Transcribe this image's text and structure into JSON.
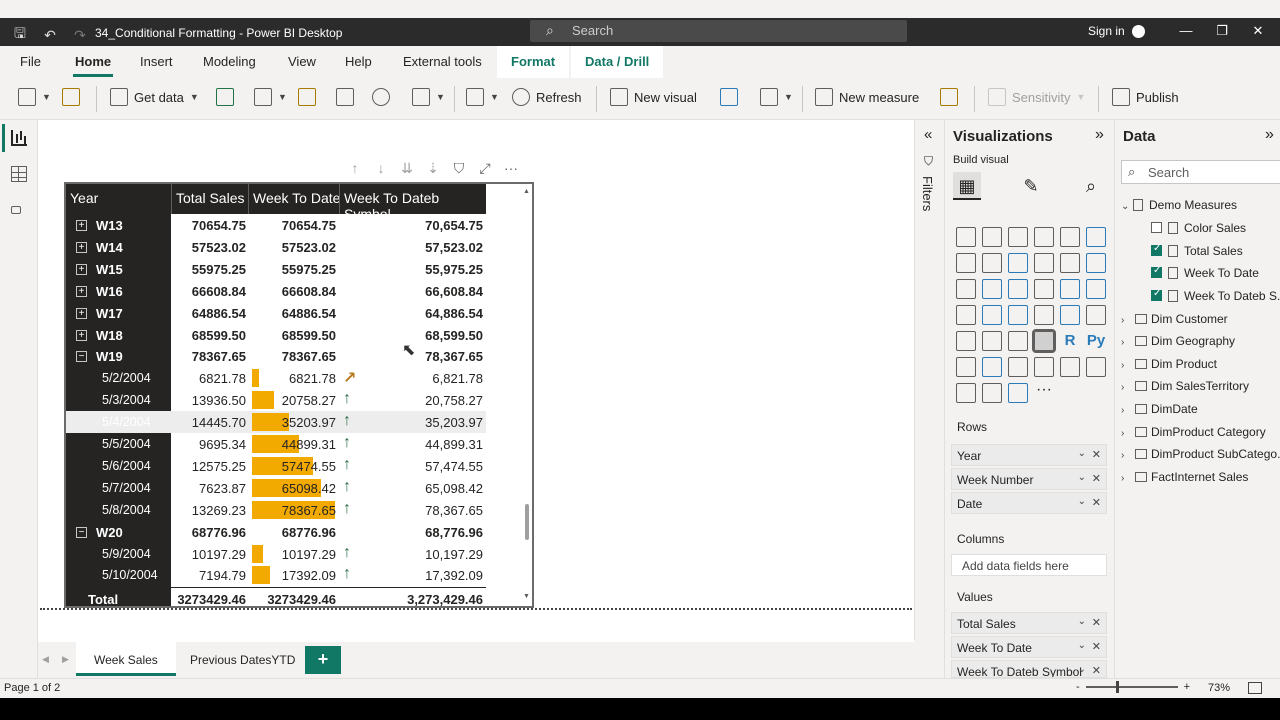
{
  "window": {
    "title": "34_Conditional Formatting - Power BI Desktop",
    "search_placeholder": "Search",
    "sign_in": "Sign in"
  },
  "menu": {
    "tabs": [
      "File",
      "Home",
      "Insert",
      "Modeling",
      "View",
      "Help",
      "External tools",
      "Format",
      "Data / Drill"
    ],
    "active": "Home"
  },
  "ribbon": {
    "get_data": "Get data",
    "refresh": "Refresh",
    "new_visual": "New visual",
    "new_measure": "New measure",
    "sensitivity": "Sensitivity",
    "publish": "Publish"
  },
  "matrix": {
    "headers": [
      "Year",
      "Total Sales",
      "Week To Date",
      "Week To Dateb Symbol"
    ],
    "rows": [
      {
        "type": "week",
        "label": "W13",
        "total_sales": "70654.75",
        "wtd": "70654.75",
        "symbol": "70,654.75",
        "expand": "+"
      },
      {
        "type": "week",
        "label": "W14",
        "total_sales": "57523.02",
        "wtd": "57523.02",
        "symbol": "57,523.02",
        "expand": "+"
      },
      {
        "type": "week",
        "label": "W15",
        "total_sales": "55975.25",
        "wtd": "55975.25",
        "symbol": "55,975.25",
        "expand": "+"
      },
      {
        "type": "week",
        "label": "W16",
        "total_sales": "66608.84",
        "wtd": "66608.84",
        "symbol": "66,608.84",
        "expand": "+"
      },
      {
        "type": "week",
        "label": "W17",
        "total_sales": "64886.54",
        "wtd": "64886.54",
        "symbol": "64,886.54",
        "expand": "+"
      },
      {
        "type": "week",
        "label": "W18",
        "total_sales": "68599.50",
        "wtd": "68599.50",
        "symbol": "68,599.50",
        "expand": "+"
      },
      {
        "type": "week",
        "label": "W19",
        "total_sales": "78367.65",
        "wtd": "78367.65",
        "symbol": "78,367.65",
        "expand": "−"
      },
      {
        "type": "date",
        "label": "5/2/2004",
        "total_sales": "6821.78",
        "wtd": "6821.78",
        "symbol": "6,821.78",
        "bar": 0.09,
        "arrow": "diag"
      },
      {
        "type": "date",
        "label": "5/3/2004",
        "total_sales": "13936.50",
        "wtd": "20758.27",
        "symbol": "20,758.27",
        "bar": 0.26,
        "arrow": "up"
      },
      {
        "type": "date",
        "label": "5/4/2004",
        "total_sales": "14445.70",
        "wtd": "35203.97",
        "symbol": "35,203.97",
        "bar": 0.45,
        "arrow": "up",
        "highlight": true
      },
      {
        "type": "date",
        "label": "5/5/2004",
        "total_sales": "9695.34",
        "wtd": "44899.31",
        "symbol": "44,899.31",
        "bar": 0.57,
        "arrow": "up"
      },
      {
        "type": "date",
        "label": "5/6/2004",
        "total_sales": "12575.25",
        "wtd": "57474.55",
        "symbol": "57,474.55",
        "bar": 0.73,
        "arrow": "up"
      },
      {
        "type": "date",
        "label": "5/7/2004",
        "total_sales": "7623.87",
        "wtd": "65098.42",
        "symbol": "65,098.42",
        "bar": 0.83,
        "arrow": "up"
      },
      {
        "type": "date",
        "label": "5/8/2004",
        "total_sales": "13269.23",
        "wtd": "78367.65",
        "symbol": "78,367.65",
        "bar": 1.0,
        "arrow": "up"
      },
      {
        "type": "week",
        "label": "W20",
        "total_sales": "68776.96",
        "wtd": "68776.96",
        "symbol": "68,776.96",
        "expand": "−"
      },
      {
        "type": "date",
        "label": "5/9/2004",
        "total_sales": "10197.29",
        "wtd": "10197.29",
        "symbol": "10,197.29",
        "bar": 0.13,
        "arrow": "up"
      },
      {
        "type": "date",
        "label": "5/10/2004",
        "total_sales": "7194.79",
        "wtd": "17392.09",
        "symbol": "17,392.09",
        "bar": 0.22,
        "arrow": "up"
      }
    ],
    "total": {
      "label": "Total",
      "total_sales": "3273429.46",
      "wtd": "3273429.46",
      "symbol": "3,273,429.46"
    },
    "bar_color": "#f2a900",
    "arrow_up_color": "#2e6f4a",
    "arrow_diag_color": "#b7791f"
  },
  "pages": {
    "tabs": [
      "Week Sales",
      "Previous DatesYTD"
    ],
    "active": "Week Sales",
    "add": "+"
  },
  "filters": {
    "label": "Filters"
  },
  "visualizations": {
    "title": "Visualizations",
    "build_visual": "Build visual",
    "rows_label": "Rows",
    "rows": [
      "Year",
      "Week Number",
      "Date"
    ],
    "columns_label": "Columns",
    "columns_placeholder": "Add data fields here",
    "values_label": "Values",
    "values": [
      "Total Sales",
      "Week To Date",
      "Week To Dateb Symbol"
    ],
    "r_icon": "R",
    "py_icon": "Py",
    "more": "···"
  },
  "data": {
    "title": "Data",
    "search_placeholder": "Search",
    "tables": [
      {
        "name": "Demo Measures",
        "expanded": true,
        "measures": [
          {
            "name": "Color Sales",
            "checked": false
          },
          {
            "name": "Total Sales",
            "checked": true
          },
          {
            "name": "Week To Date",
            "checked": true
          },
          {
            "name": "Week To Dateb S...",
            "checked": true
          }
        ]
      },
      {
        "name": "Dim Customer"
      },
      {
        "name": "Dim Geography"
      },
      {
        "name": "Dim Product"
      },
      {
        "name": "Dim SalesTerritory"
      },
      {
        "name": "DimDate"
      },
      {
        "name": "DimProduct Category"
      },
      {
        "name": "DimProduct SubCatego..."
      },
      {
        "name": "FactInternet Sales"
      }
    ]
  },
  "status": {
    "page": "Page 1 of 2",
    "zoom_minus": "-",
    "zoom_plus": "+",
    "zoom": "73%"
  },
  "colors": {
    "accent": "#117865"
  }
}
